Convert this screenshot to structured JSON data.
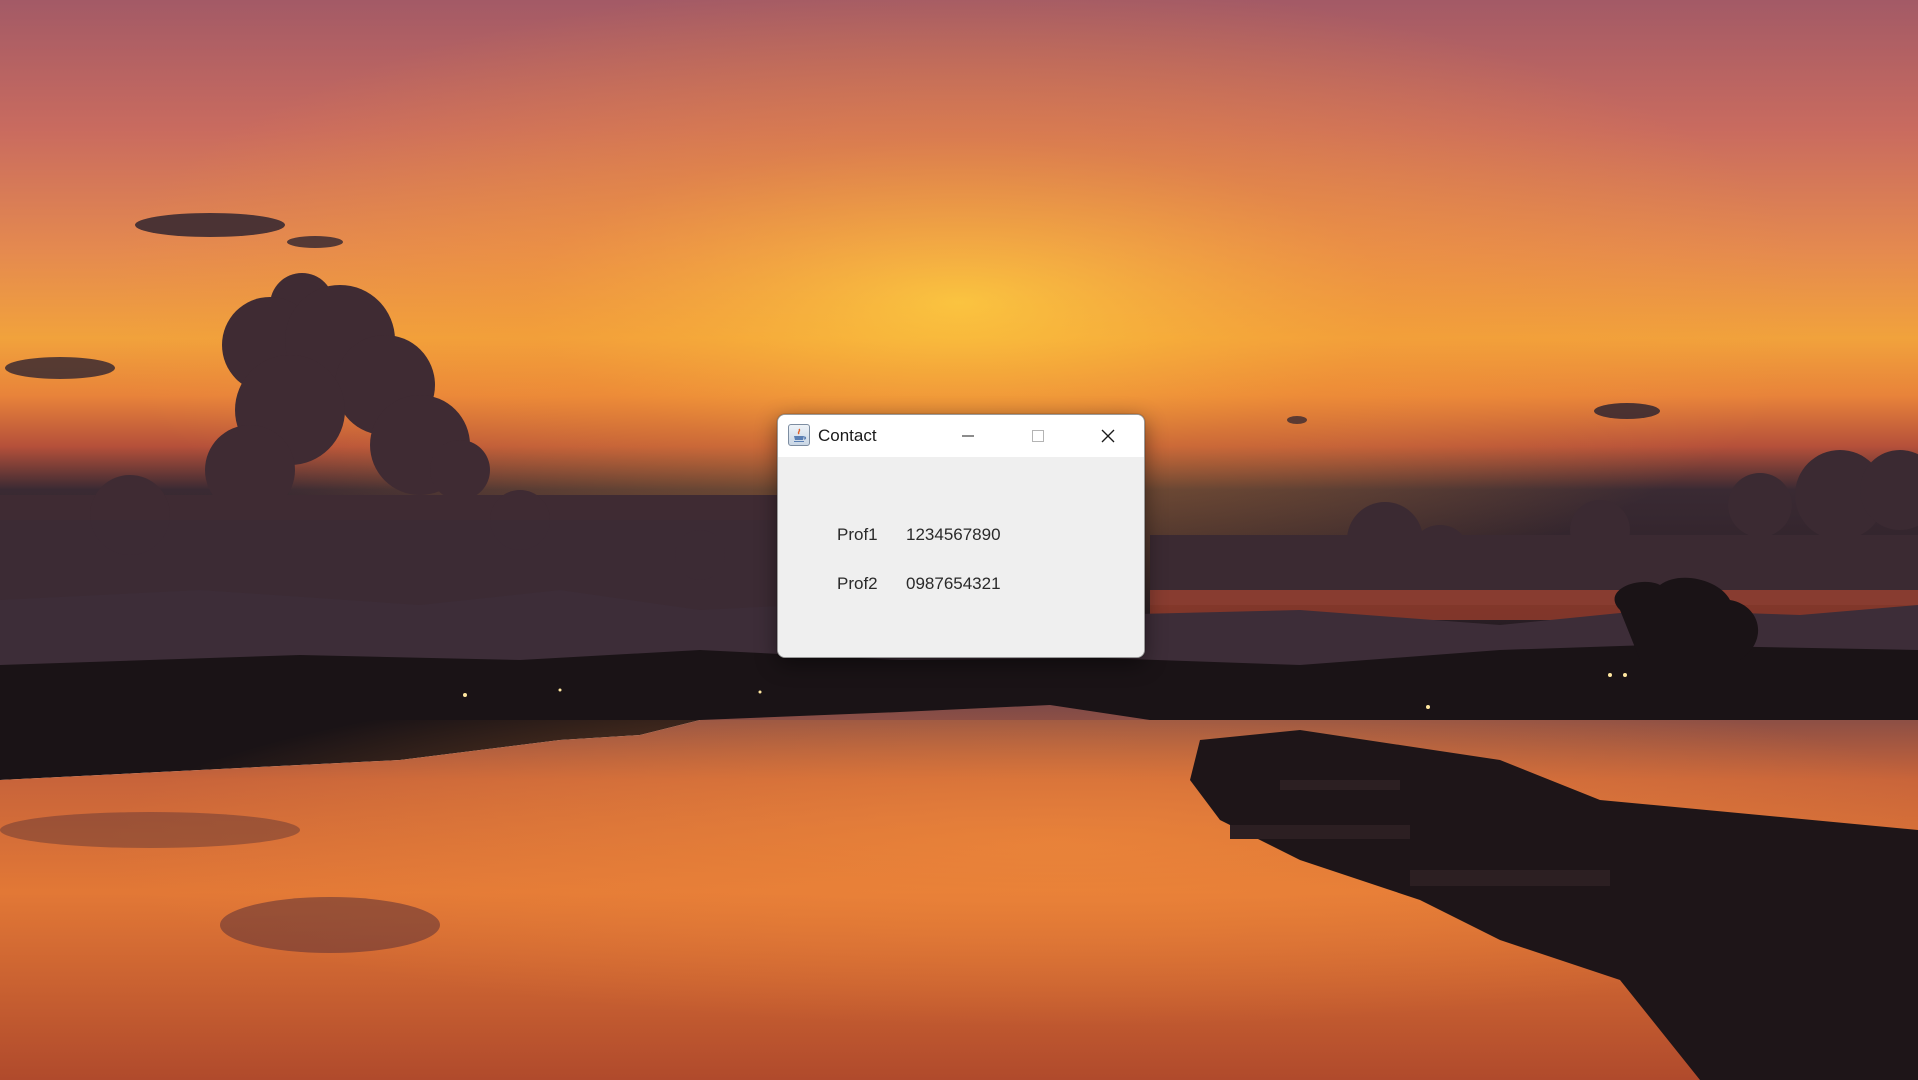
{
  "window": {
    "title": "Contact",
    "icon": "java-app-icon"
  },
  "title_bar_buttons": [
    {
      "name": "minimize",
      "icon": "minimize-icon"
    },
    {
      "name": "maximize",
      "icon": "maximize-icon",
      "disabled": true
    },
    {
      "name": "close",
      "icon": "close-icon"
    }
  ],
  "contacts": [
    {
      "name": "Prof1",
      "number": "1234567890"
    },
    {
      "name": "Prof2",
      "number": "0987654321"
    }
  ],
  "colors": {
    "window_background": "#efefef",
    "title_bar": "#ffffff",
    "text": "#2a2a2a"
  }
}
